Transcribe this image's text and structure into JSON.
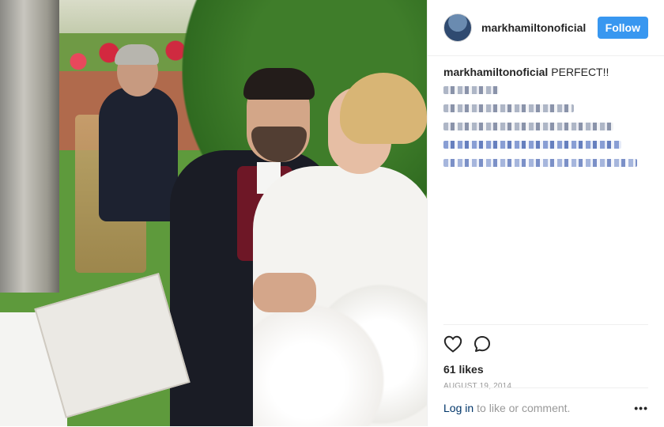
{
  "post": {
    "username": "markhamiltonoficial",
    "follow_label": "Follow",
    "caption_user": "markhamiltonoficial",
    "caption_text": "PERFECT!!",
    "likes": "61 likes",
    "date": "AUGUST 19, 2014",
    "login_link": "Log in",
    "login_suffix": "to like or comment.",
    "more_label": "•••"
  },
  "icons": {
    "like": "heart-icon",
    "comment": "comment-icon",
    "more": "more-options-icon"
  },
  "colors": {
    "follow_button": "#3897f0",
    "link": "#003569",
    "muted_text": "#999999"
  }
}
